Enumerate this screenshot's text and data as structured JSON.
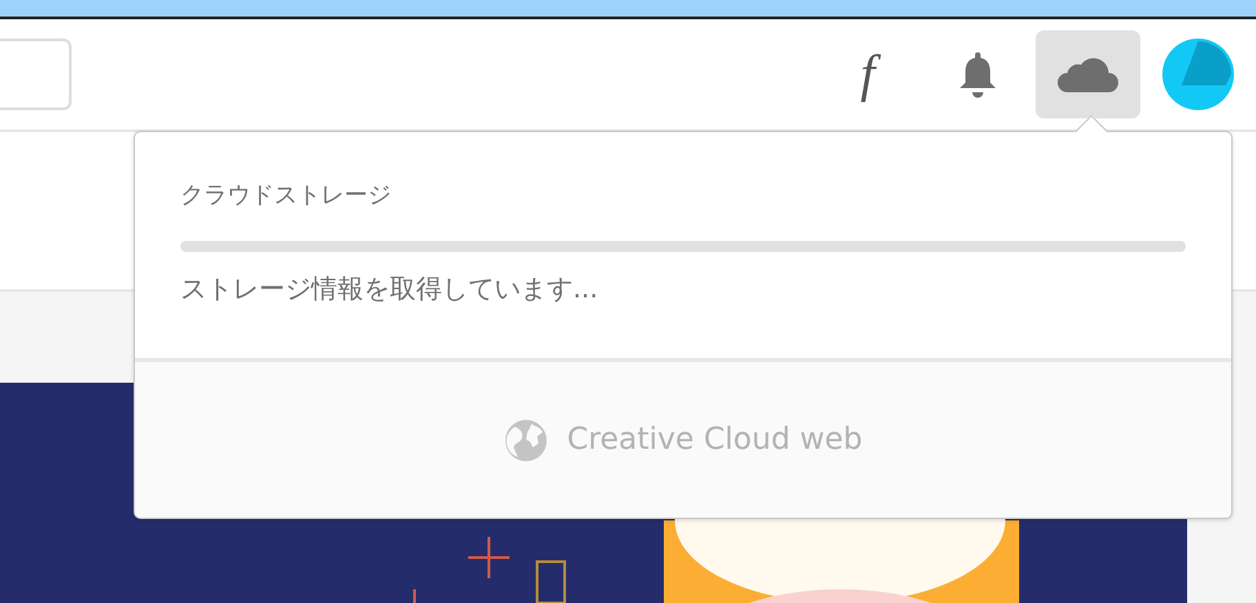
{
  "header": {
    "toolbar": [
      {
        "kind": "font",
        "label": "f",
        "selected": false
      },
      {
        "kind": "bell",
        "selected": false
      },
      {
        "kind": "cloud",
        "selected": true
      },
      {
        "kind": "avatar",
        "selected": false
      }
    ]
  },
  "storage_popover": {
    "title": "クラウドストレージ",
    "status": "ストレージ情報を取得しています...",
    "footer_link": "Creative Cloud web"
  }
}
